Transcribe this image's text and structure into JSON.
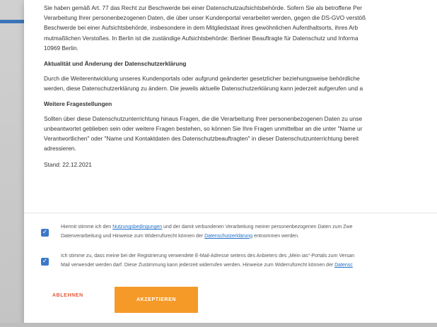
{
  "colors": {
    "accent": "#f59a28",
    "checkbox": "#3c78c8",
    "link": "#1f6fc5",
    "decline": "#e05a3b"
  },
  "privacy": {
    "p1": [
      "Sie haben gemäß Art. 77 das Recht zur Beschwerde bei einer Datenschutzaufsichtsbehörde. Sofern Sie als betroffene Per",
      "Verarbeitung Ihrer personenbezogenen Daten, die über unser Kundenportal verarbeitet werden, gegen die DS-GVO verstöß",
      "Beschwerde bei einer Aufsichtsbehörde, insbesondere in dem Mitgliedstaat ihres gewöhnlichen Aufenthaltsorts, ihres Arb",
      "mutmaßlichen Verstoßes. In Berlin ist die zuständige Aufsichtsbehörde: Berliner Beauftragte für Datenschutz und Informa",
      "10969 Berlin."
    ],
    "h2": "Aktualität und Änderung der Datenschutzerklärung",
    "p2": [
      "Durch die Weiterentwicklung unseres Kundenportals oder aufgrund geänderter gesetzlicher beziehungsweise behördliche",
      "werden, diese Datenschutzerklärung zu ändern. Die jeweils aktuelle Datenschutzerklärung kann jederzeit aufgerufen und a"
    ],
    "h3": "Weitere Fragestellungen",
    "p3": [
      "Sollten über diese Datenschutzunterrichtung hinaus Fragen, die die Verarbeitung Ihrer personenbezogenen Daten zu unse",
      "unbeantwortet geblieben sein oder weitere Fragen bestehen, so können Sie Ihre Fragen unmittelbar an die unter \"Name ur",
      "Verantwortlichen\" oder \"Name und Kontaktdaten des Datenschutzbeauftragten\" in dieser Datenschutzunterrichtung bereit",
      "adressieren."
    ],
    "stand": "Stand: 22.12.2021"
  },
  "consent1": {
    "checked": true,
    "line1_before": "Hiermit stimme ich den ",
    "link1": "Nutzungsbedingungen",
    "line1_after": " und der damit verbundenen Verarbeitung meiner personenbezogenen Daten zum Zwe",
    "line2_before": "Datenverarbeitung und Hinweise zum Widerrufsrecht können der ",
    "link2": "Datenschutzerklärung",
    "line2_after": " entnommen werden."
  },
  "consent2": {
    "checked": true,
    "line1": "Ich stimme zu, dass meine bei der Registrierung verwendete E-Mail-Adresse seitens des Anbieters des „Mein ias“-Portals zum Versan",
    "line2_before": "Mail verwendet werden darf. Diese Zustimmung kann jederzeit widerrufen werden. Hinweise zum Widerrufsrecht können der ",
    "link": "Datensc"
  },
  "buttons": {
    "decline": "ABLEHNEN",
    "accept": "AKZEPTIEREN"
  },
  "icons": {
    "checkbox": "checkmark-icon"
  }
}
